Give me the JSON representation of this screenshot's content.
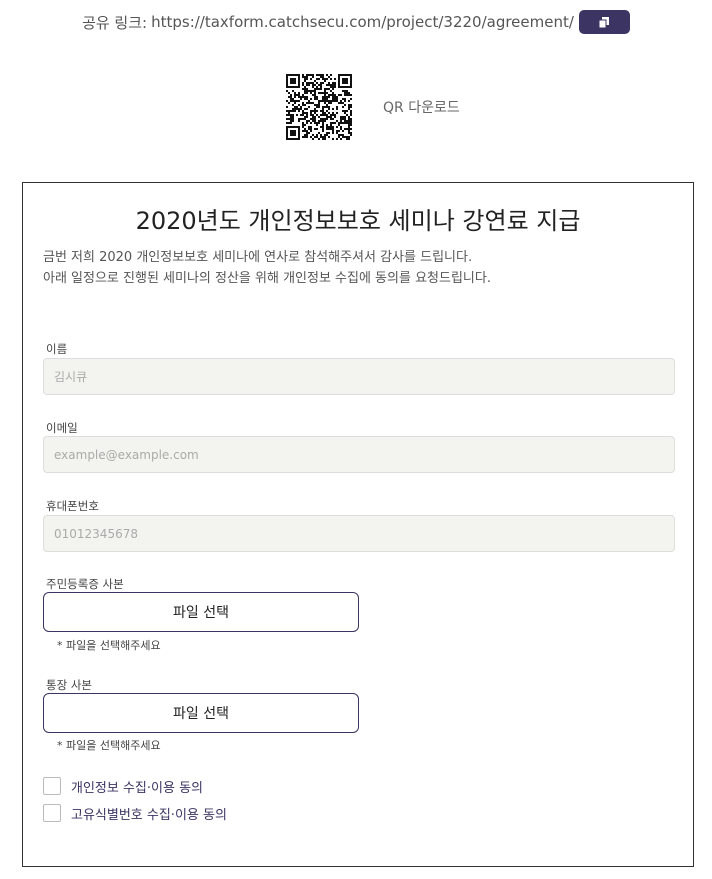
{
  "share": {
    "label": "공유 링크:",
    "url": "https://taxform.catchsecu.com/project/3220/agreement/",
    "copy_icon": "copy-icon"
  },
  "qr": {
    "download_label": "QR 다운로드"
  },
  "form": {
    "title": "2020년도 개인정보보호 세미나 강연료 지급",
    "description": [
      "금번 저희 2020 개인정보보호 세미나에 연사로 참석해주셔서 감사를 드립니다.",
      "아래 일정으로 진행된 세미나의 정산을 위해 개인정보 수집에 동의를 요청드립니다."
    ],
    "fields": {
      "name": {
        "label": "이름",
        "placeholder": "김시큐"
      },
      "email": {
        "label": "이메일",
        "placeholder": "example@example.com"
      },
      "phone": {
        "label": "휴대폰번호",
        "placeholder": "01012345678"
      }
    },
    "uploads": {
      "id_copy": {
        "label": "주민등록증 사본",
        "button": "파일 선택",
        "hint": "* 파일을 선택해주세요"
      },
      "bankbook_copy": {
        "label": "통장 사본",
        "button": "파일 선택",
        "hint": "* 파일을 선택해주세요"
      }
    },
    "consents": [
      {
        "label": "개인정보 수집·이용 동의",
        "checked": false
      },
      {
        "label": "고유식별번호 수집·이용 동의",
        "checked": false
      }
    ]
  },
  "colors": {
    "accent": "#3c3563",
    "input_bg": "#f3f3ef"
  }
}
